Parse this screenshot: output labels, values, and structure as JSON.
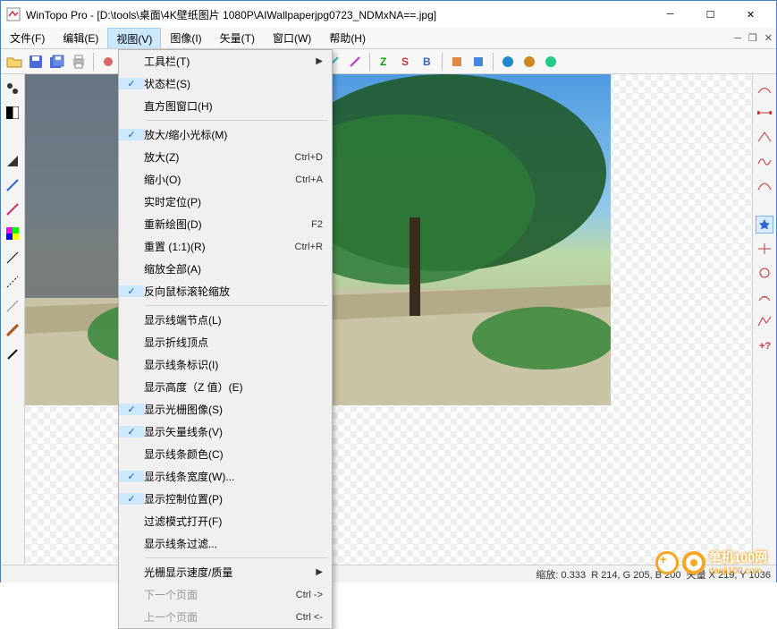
{
  "window": {
    "title": "WinTopo Pro - [D:\\tools\\桌面\\4K壁纸图片 1080P\\AIWallpaperjpg0723_NDMxNA==.jpg]"
  },
  "menubar": {
    "items": [
      "文件(F)",
      "编辑(E)",
      "视图(V)",
      "图像(I)",
      "矢量(T)",
      "窗口(W)",
      "帮助(H)"
    ],
    "open_index": 2
  },
  "view_menu": {
    "groups": [
      [
        {
          "label": "工具栏(T)",
          "checked": false,
          "submenu": true
        },
        {
          "label": "状态栏(S)",
          "checked": true
        },
        {
          "label": "直方图窗口(H)"
        }
      ],
      [
        {
          "label": "放大/缩小光标(M)",
          "checked": true
        },
        {
          "label": "放大(Z)",
          "shortcut": "Ctrl+D"
        },
        {
          "label": "缩小(O)",
          "shortcut": "Ctrl+A"
        },
        {
          "label": "实时定位(P)"
        },
        {
          "label": "重新绘图(D)",
          "shortcut": "F2"
        },
        {
          "label": "重置 (1:1)(R)",
          "shortcut": "Ctrl+R"
        },
        {
          "label": "缩放全部(A)"
        },
        {
          "label": "反向鼠标滚轮缩放",
          "checked": true
        }
      ],
      [
        {
          "label": "显示线端节点(L)"
        },
        {
          "label": "显示折线顶点"
        },
        {
          "label": "显示线条标识(I)"
        },
        {
          "label": "显示高度（Z 值）(E)"
        },
        {
          "label": "显示光栅图像(S)",
          "checked": true
        },
        {
          "label": "显示矢量线条(V)",
          "checked": true
        },
        {
          "label": "显示线条颜色(C)"
        },
        {
          "label": "显示线条宽度(W)...",
          "checked": true
        },
        {
          "label": "显示控制位置(P)",
          "checked": true
        },
        {
          "label": "过滤模式打开(F)"
        },
        {
          "label": "显示线条过滤..."
        }
      ],
      [
        {
          "label": "光栅显示速度/质量",
          "submenu": true
        },
        {
          "label": "下一个页面",
          "shortcut": "Ctrl ->",
          "disabled": true
        },
        {
          "label": "上一个页面",
          "shortcut": "Ctrl <-",
          "disabled": true
        }
      ]
    ]
  },
  "statusbar": {
    "zoom_label": "缩放:",
    "zoom": "0.333",
    "rgb": "R 214, G 205, B 200",
    "vec_label": "矢量",
    "vec": "X 219, Y 1036"
  },
  "watermark": {
    "line1": "单机100网",
    "line2": "danji100.com"
  },
  "toolbar_icons": [
    "open",
    "save",
    "saveall",
    "print",
    "sep",
    "a",
    "b",
    "sep",
    "c",
    "d",
    "sep",
    "e",
    "f",
    "sep",
    "circ1",
    "circ2",
    "sep",
    "pen1",
    "pen2",
    "pen3",
    "sep",
    "z",
    "s",
    "b2",
    "sep",
    "sq1",
    "sq2",
    "sep",
    "cc1",
    "cc2",
    "cc3"
  ],
  "left_icons": [
    "dot",
    "bw",
    "mo",
    "wedge",
    "sl",
    "sl2",
    "mag",
    "col",
    "bl",
    "bl2",
    "bl3",
    "br",
    "pen"
  ],
  "right_icons": [
    "v1",
    "v2",
    "v3",
    "v4",
    "v5",
    "sep",
    "star",
    "v6",
    "v7",
    "v8",
    "v9",
    "vq"
  ]
}
